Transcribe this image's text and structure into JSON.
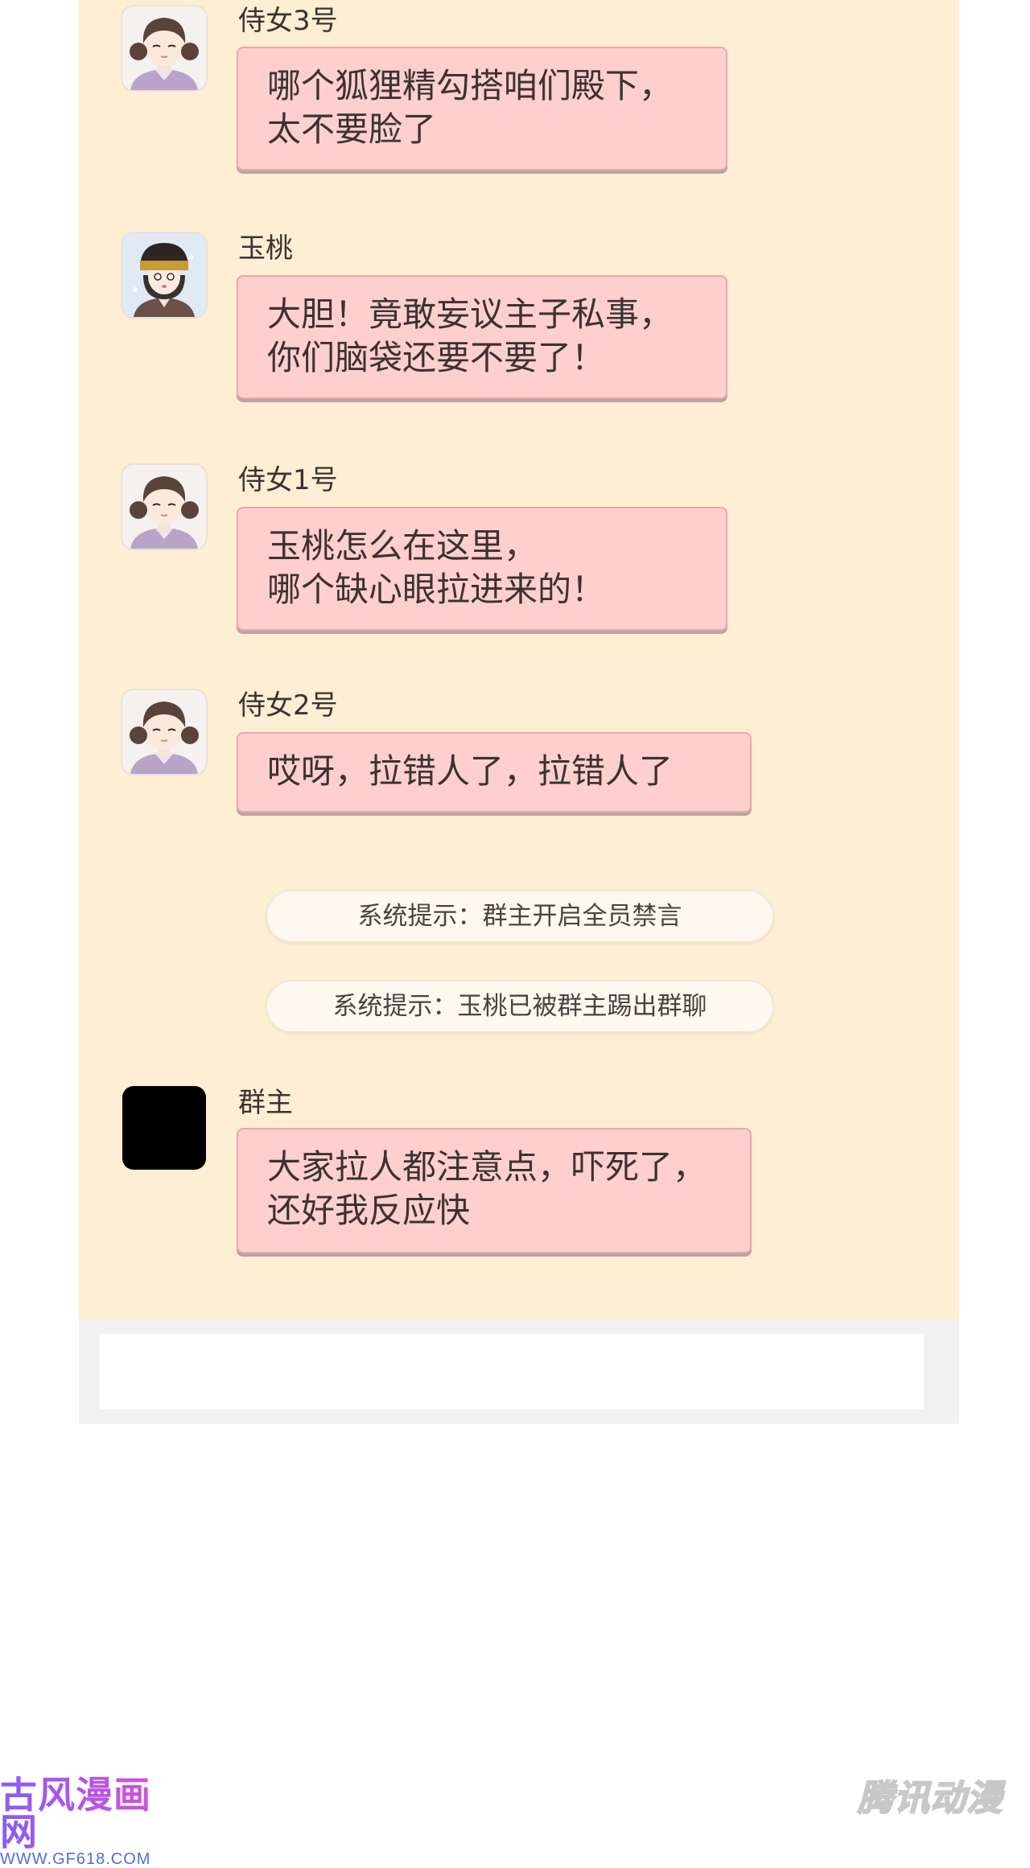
{
  "messages": [
    {
      "sender": "侍女3号",
      "text": "哪个狐狸精勾搭咱们殿下，\n太不要脸了",
      "avatar": "maid-avatar"
    },
    {
      "sender": "玉桃",
      "text": "大胆！竟敢妄议主子私事，\n你们脑袋还要不要了！",
      "avatar": "yutao-avatar"
    },
    {
      "sender": "侍女1号",
      "text": "玉桃怎么在这里，\n哪个缺心眼拉进来的！",
      "avatar": "maid-avatar"
    },
    {
      "sender": "侍女2号",
      "text": "哎呀，拉错人了，拉错人了",
      "avatar": "maid-avatar"
    },
    {
      "sender": "群主",
      "text": "大家拉人都注意点，吓死了，\n还好我反应快",
      "avatar": "black-avatar"
    }
  ],
  "system_notices": [
    "系统提示：群主开启全员禁言",
    "系统提示：玉桃已被群主踢出群聊"
  ],
  "watermarks": {
    "left_brand": "古风漫画网",
    "left_url": "WWW.GF618.COM",
    "right_brand": "腾讯动漫"
  },
  "colors": {
    "chat_background": "#fdeed4",
    "bubble": "#ffcfcf",
    "notice_pill": "#fff8ee",
    "input_area": "#f1f1f1"
  }
}
